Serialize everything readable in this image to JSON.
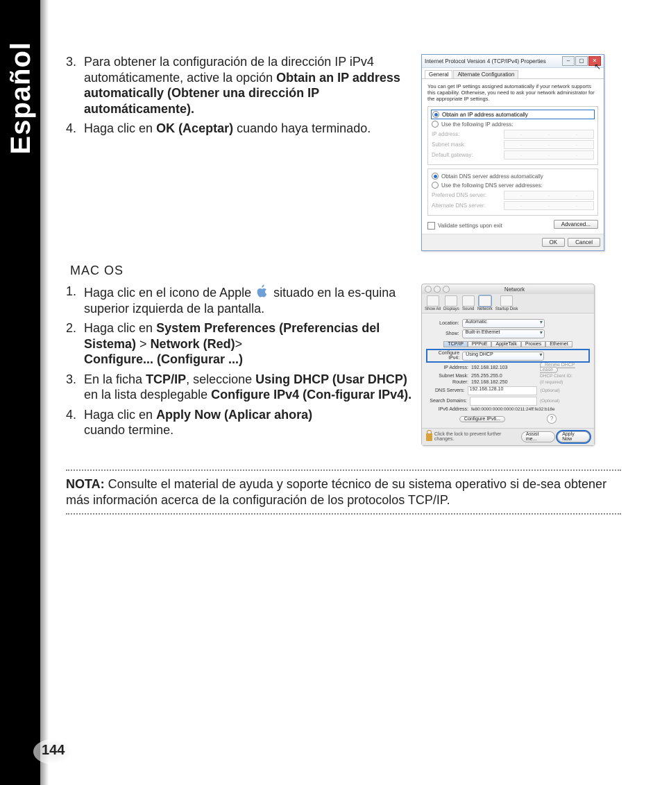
{
  "side_label": "Español",
  "page_number": "144",
  "steps_top": [
    {
      "n": "3.",
      "pre": "Para obtener la configuración de la dirección IP iPv4 automáticamente, active la opción ",
      "bold": "Obtain an IP address automatically (Obtener una dirección IP automáticamente)."
    },
    {
      "n": "4.",
      "pre": "Haga clic en ",
      "bold": "OK (Aceptar)",
      "post": " cuando haya terminado."
    }
  ],
  "macos_heading": "MAC OS",
  "steps_mac": [
    {
      "n": "1.",
      "pre": "Haga clic en el icono de Apple ",
      "icon": true,
      "post": " situado en la es-quina superior izquierda de la pantalla."
    },
    {
      "n": "2.",
      "pre": "Haga clic en ",
      "b1": "System Preferences (Preferencias del Sistema)",
      "mid1": " > ",
      "b2": "Network (Red)",
      "mid2": "> ",
      "b3": "Configure... (Configurar ...)"
    },
    {
      "n": "3.",
      "pre": "En la ficha ",
      "b1": "TCP/IP",
      "mid1": ", seleccione ",
      "b2": "Using DHCP (Usar DHCP)",
      "mid2": " en la lista desplegable ",
      "b3": "Configure IPv4 (Con-figurar IPv4)."
    },
    {
      "n": "4.",
      "pre": "Haga clic en ",
      "b1": "Apply Now (Aplicar ahora)",
      "post": " cuando termine."
    }
  ],
  "note_label": "NOTA:",
  "note_text": " Consulte el material de ayuda y soporte técnico de su sistema operativo si de-sea obtener más información acerca de la configuración de los protocolos TCP/IP.",
  "win": {
    "title": "Internet Protocol Version 4 (TCP/IPv4) Properties",
    "tab1": "General",
    "tab2": "Alternate Configuration",
    "desc": "You can get IP settings assigned automatically if your network supports this capability. Otherwise, you need to ask your network administrator for the appropriate IP settings.",
    "r1": "Obtain an IP address automatically",
    "r2": "Use the following IP address:",
    "f1": "IP address:",
    "f2": "Subnet mask:",
    "f3": "Default gateway:",
    "r3": "Obtain DNS server address automatically",
    "r4": "Use the following DNS server addresses:",
    "f4": "Preferred DNS server:",
    "f5": "Alternate DNS server:",
    "validate": "Validate settings upon exit",
    "advanced": "Advanced...",
    "ok": "OK",
    "cancel": "Cancel"
  },
  "mac": {
    "title": "Network",
    "toolbar": [
      "Show All",
      "Displays",
      "Sound",
      "Network",
      "Startup Disk"
    ],
    "location_lbl": "Location:",
    "location_val": "Automatic",
    "show_lbl": "Show:",
    "show_val": "Built-in Ethernet",
    "tabs": [
      "TCP/IP",
      "PPPoE",
      "AppleTalk",
      "Proxies",
      "Ethernet"
    ],
    "cfg_lbl": "Configure IPv4:",
    "cfg_val": "Using DHCP",
    "ip_lbl": "IP Address:",
    "ip_val": "192.168.182.103",
    "renew": "Renew DHCP Lease",
    "sm_lbl": "Subnet Mask:",
    "sm_val": "255.255.255.0",
    "client_lbl": "DHCP Client ID:",
    "rt_lbl": "Router:",
    "rt_val": "192.168.182.250",
    "if_req": "(if required)",
    "dns_lbl": "DNS Servers:",
    "dns_val": "192.168.128.10",
    "optional": "(Optional)",
    "sd_lbl": "Search Domains:",
    "ipv6_lbl": "IPv6 Address:",
    "ipv6_val": "fe80:0000:0000:0000:0211:24ff:fe32:b18e",
    "cfg6": "Configure IPv6...",
    "lock_text": "Click the lock to prevent further changes.",
    "assist": "Assist me...",
    "apply": "Apply Now"
  }
}
